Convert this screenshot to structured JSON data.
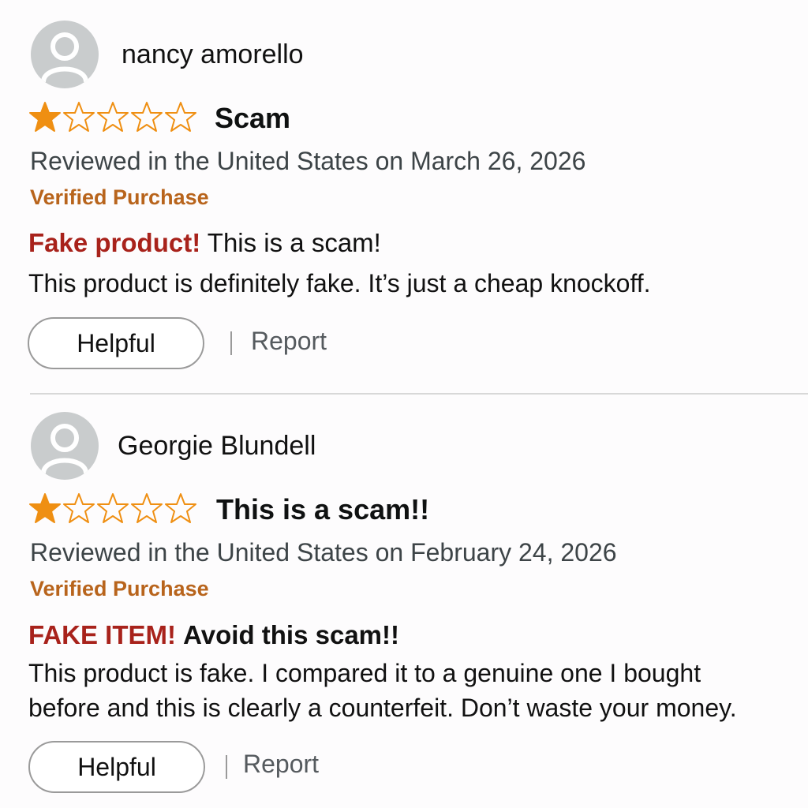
{
  "colors": {
    "star_fill": "#ef8f12",
    "star_outline": "#ef8f12",
    "verified": "#b8641c",
    "headline_red": "#a8221b"
  },
  "reviews": [
    {
      "reviewer": "nancy amorello",
      "avatar_icon": "user-silhouette-icon",
      "rating": 1,
      "rating_max": 5,
      "title": "Scam",
      "date": "Reviewed in the United States on March 26, 2026",
      "verified": "Verified Purchase",
      "headline_emphasis": "Fake product!",
      "headline_rest": "This is a scam!",
      "body": "This product is definitely fake. It’s just a cheap knockoff.",
      "helpful_label": "Helpful",
      "report_label": "Report"
    },
    {
      "reviewer": "Georgie Blundell",
      "avatar_icon": "user-silhouette-icon",
      "rating": 1,
      "rating_max": 5,
      "title": "This is a scam!!",
      "date": "Reviewed in the United States on February 24, 2026",
      "verified": "Verified Purchase",
      "headline_emphasis": "FAKE ITEM!",
      "headline_rest": "Avoid this scam!!",
      "body_line1": "This product is fake. I compared it to a genuine one I bought",
      "body_line2": "before and this is clearly a counterfeit. Don’t waste your money.",
      "helpful_label": "Helpful",
      "report_label": "Report"
    }
  ]
}
